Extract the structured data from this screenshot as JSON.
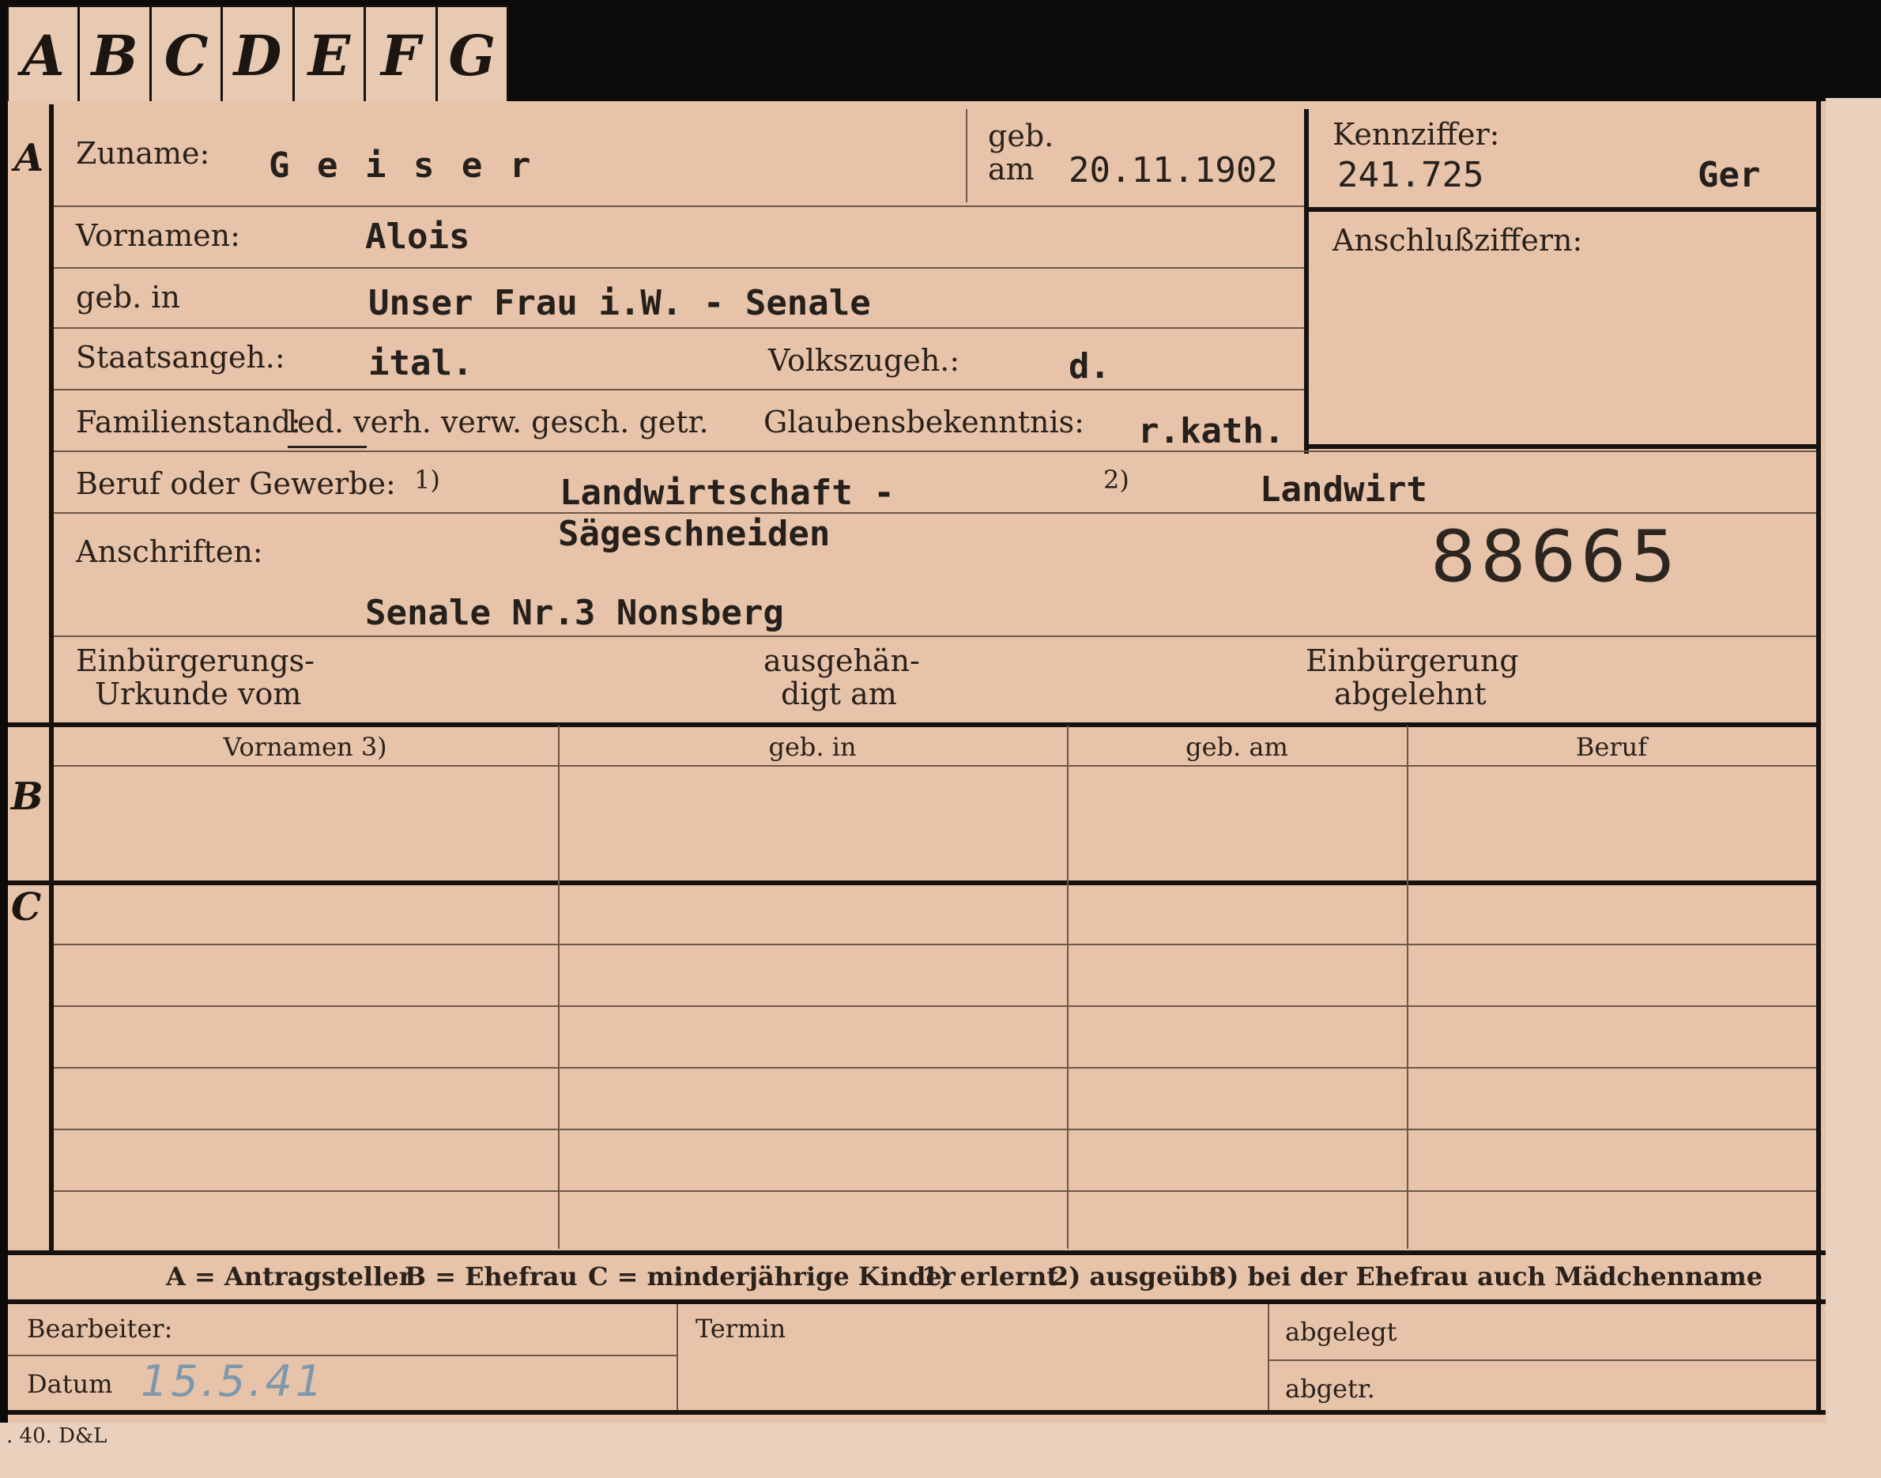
{
  "tabs": [
    "A",
    "B",
    "C",
    "D",
    "E",
    "F",
    "G"
  ],
  "sections": {
    "a": "A",
    "b": "B",
    "c": "C"
  },
  "header": {
    "surname_label": "Zuname:",
    "surname_value": "G e i s e r",
    "born_label_1": "geb.",
    "born_label_2": "am",
    "born_value": "20.11.1902",
    "kennziffer_label": "Kennziffer:",
    "kennziffer_value": "241.725",
    "kennziffer_code": "Ger",
    "anschluss_label": "Anschlußziffern:"
  },
  "person": {
    "firstname_label": "Vornamen:",
    "firstname_value": "Alois",
    "birthplace_label": "geb. in",
    "birthplace_value": "Unser Frau i.W. - Senale",
    "citizenship_label": "Staatsangeh.:",
    "citizenship_value": "ital.",
    "ethnicity_label": "Volkszugeh.:",
    "ethnicity_value": "d.",
    "marital_label": "Familienstand:",
    "marital_options": "led. verh. verw. gesch. getr.",
    "religion_label": "Glaubensbekenntnis:",
    "religion_value": "r.kath.",
    "occupation_label": "Beruf oder Gewerbe:",
    "occupation_note1": "1)",
    "occupation_value1a": "Landwirtschaft -",
    "occupation_value1b": "Sägeschneiden",
    "occupation_note2": "2)",
    "occupation_value2": "Landwirt",
    "address_label": "Anschriften:",
    "address_value": "Senale Nr.3 Nonsberg",
    "stamp_number": "88665",
    "naturalization_label_1": "Einbürgerungs-",
    "naturalization_label_2": "Urkunde vom",
    "handed_label_1": "ausgehän-",
    "handed_label_2": "digt am",
    "rejected_label_1": "Einbürgerung",
    "rejected_label_2": "abgelehnt"
  },
  "spouse_table": {
    "headers": [
      "Vornamen 3)",
      "geb. in",
      "geb. am",
      "Beruf"
    ]
  },
  "legend": {
    "a": "A = Antragsteller",
    "b": "B = Ehefrau",
    "c": "C = minderjährige Kinder",
    "n1": "1) erlernt",
    "n2": "2) ausgeübt",
    "n3": "3) bei der Ehefrau auch Mädchenname"
  },
  "footer": {
    "clerk_label": "Bearbeiter:",
    "date_label": "Datum",
    "date_value": "15.5.41",
    "term_label": "Termin",
    "filed_label": "abgelegt",
    "entered_label": "abgetr.",
    "print_code": ". 40. D&L"
  }
}
